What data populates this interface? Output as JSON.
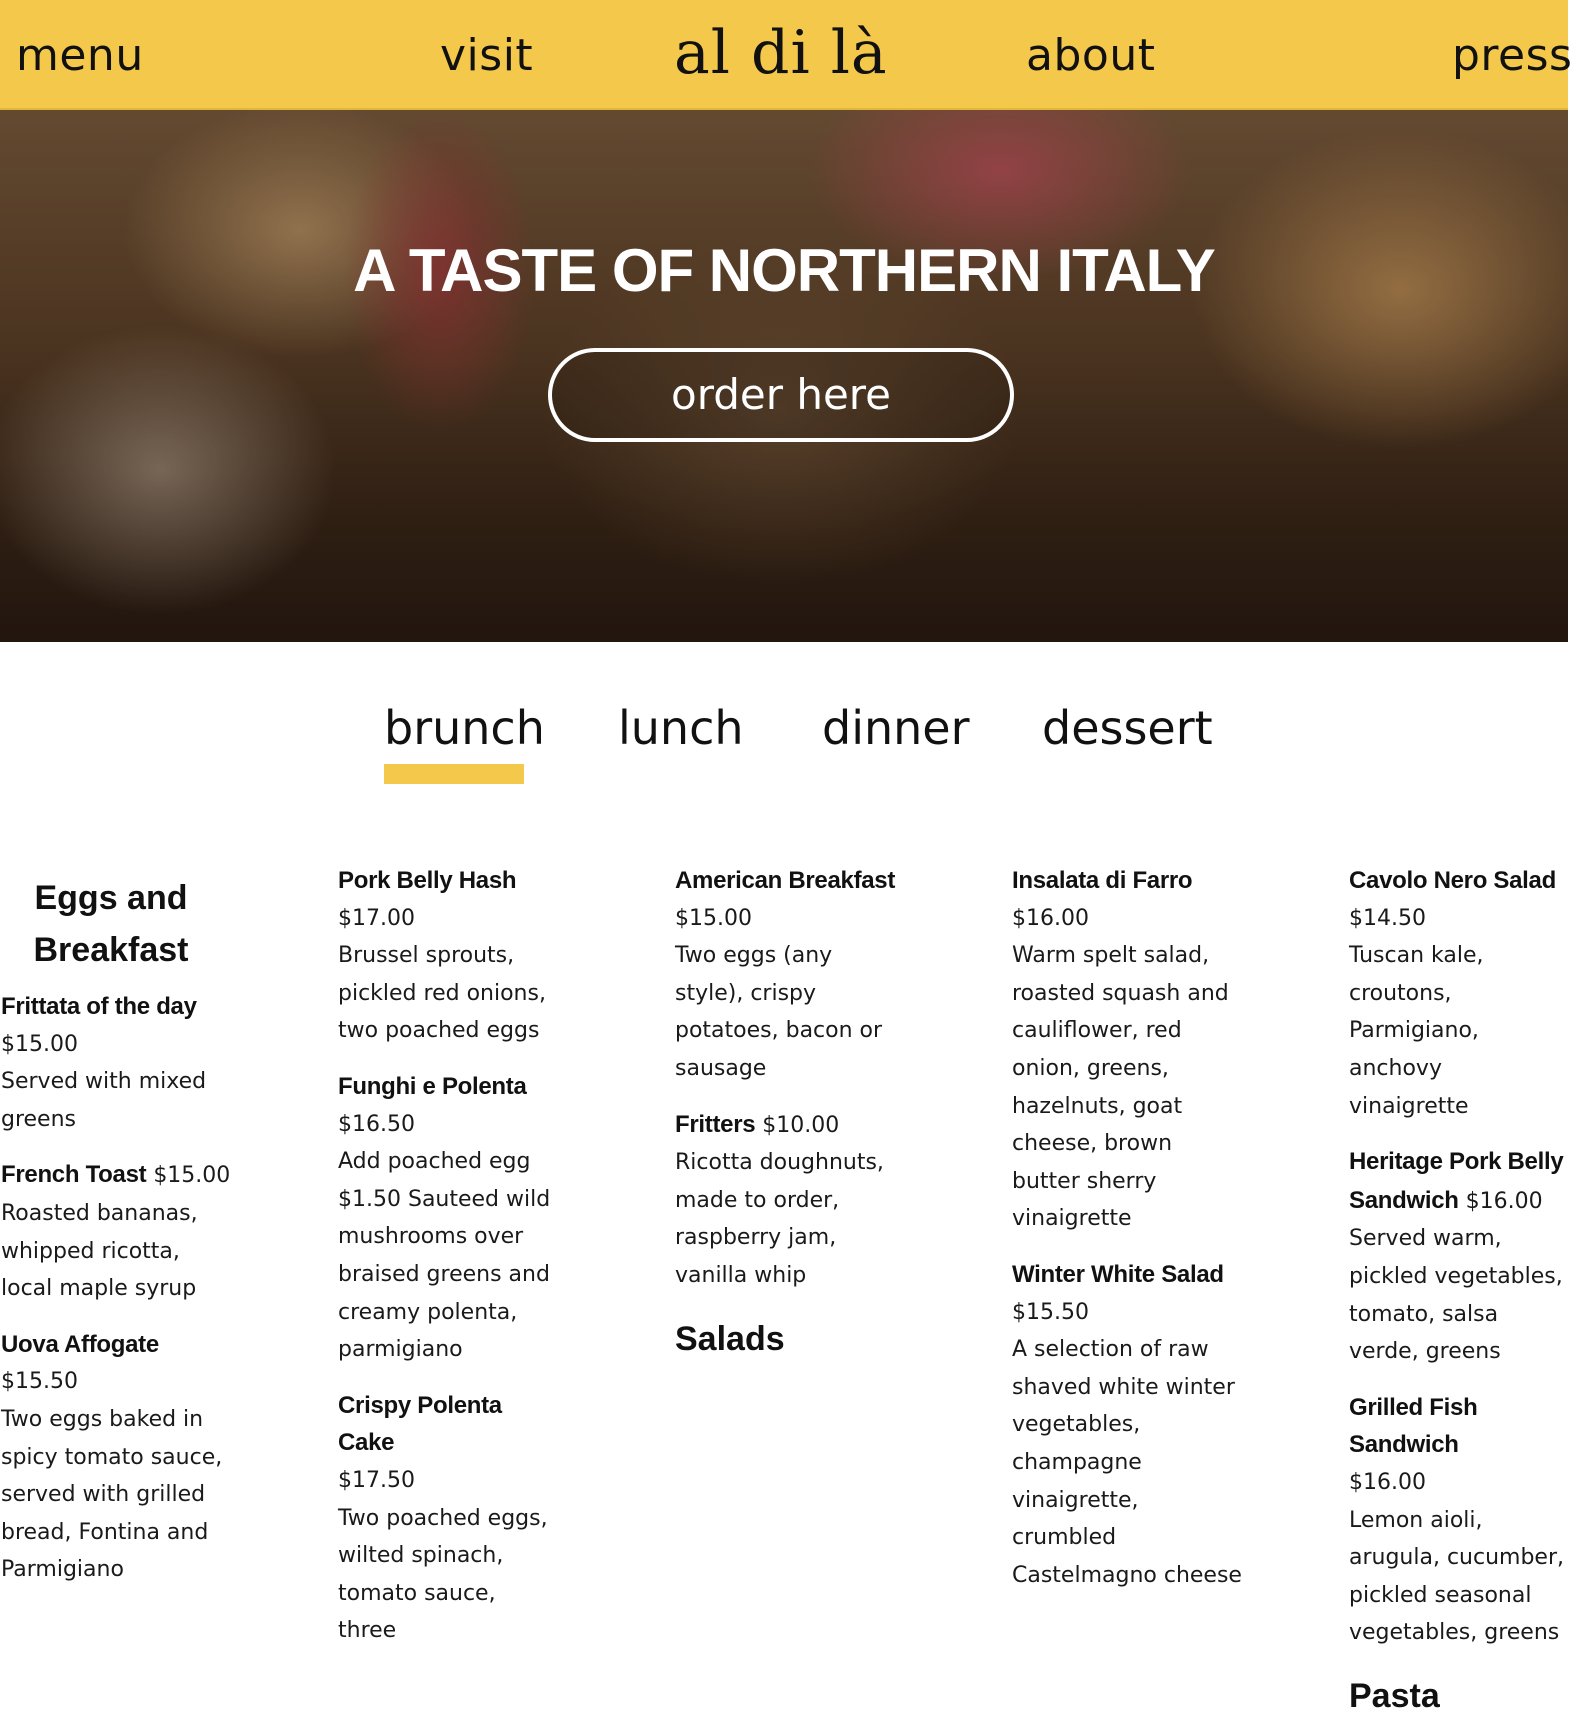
{
  "nav": {
    "menu": "menu",
    "visit": "visit",
    "logo": "al di là",
    "about": "about",
    "press": "press"
  },
  "hero": {
    "title": "A TASTE OF NORTHERN ITALY",
    "cta": "order here"
  },
  "tabs": [
    "brunch",
    "lunch",
    "dinner",
    "dessert"
  ],
  "active_tab": "brunch",
  "colors": {
    "accent": "#f4c84a"
  },
  "columns": {
    "c1": {
      "section": "Eggs and Breakfast",
      "items": [
        {
          "name": "Frittata of the day",
          "price": "$15.00",
          "desc": "Served with mixed greens"
        },
        {
          "name": "French Toast",
          "price": "$15.00",
          "desc": "Roasted bananas, whipped ricotta, local maple syrup"
        },
        {
          "name": "Uova Affogate",
          "price": "$15.50",
          "desc": "Two eggs baked in spicy tomato sauce, served with grilled bread, Fontina and Parmigiano"
        }
      ]
    },
    "c2": {
      "items": [
        {
          "name": "Pork Belly Hash",
          "price": "$17.00",
          "desc": "Brussel sprouts, pickled red onions, two poached eggs"
        },
        {
          "name": "Funghi e Polenta",
          "price": "$16.50",
          "desc": "Add poached egg $1.50 Sauteed wild mushrooms over braised greens and creamy polenta, parmigiano"
        },
        {
          "name": "Crispy Polenta Cake",
          "price": "$17.50",
          "desc": "Two poached eggs, wilted spinach, tomato sauce, three"
        }
      ]
    },
    "c3": {
      "items": [
        {
          "name": "American Breakfast",
          "price": "$15.00",
          "desc": "Two eggs (any style), crispy potatoes, bacon or sausage"
        },
        {
          "name": "Fritters",
          "price": "$10.00",
          "desc": "Ricotta doughnuts, made to order, raspberry jam, vanilla whip"
        }
      ],
      "section": "Salads"
    },
    "c4": {
      "items": [
        {
          "name": "Insalata di Farro",
          "price": "$16.00",
          "desc": "Warm spelt salad, roasted squash and cauliflower, red onion, greens, hazelnuts, goat cheese, brown butter sherry vinaigrette"
        },
        {
          "name": "Winter White Salad",
          "price": "$15.50",
          "desc": "A selection of raw shaved white winter vegetables, champagne vinaigrette, crumbled Castelmagno cheese"
        }
      ]
    },
    "c5": {
      "items": [
        {
          "name": "Cavolo Nero Salad",
          "price": "$14.50",
          "desc": "Tuscan kale, croutons, Parmigiano, anchovy vinaigrette"
        },
        {
          "name": "Heritage Pork Belly Sandwich",
          "price": "$16.00",
          "desc": "Served warm, pickled vegetables, tomato, salsa verde, greens"
        },
        {
          "name": "Grilled Fish Sandwich",
          "price": "$16.00",
          "desc": "Lemon aioli, arugula, cucumber, pickled seasonal vegetables, greens"
        }
      ],
      "section": "Pasta"
    }
  }
}
